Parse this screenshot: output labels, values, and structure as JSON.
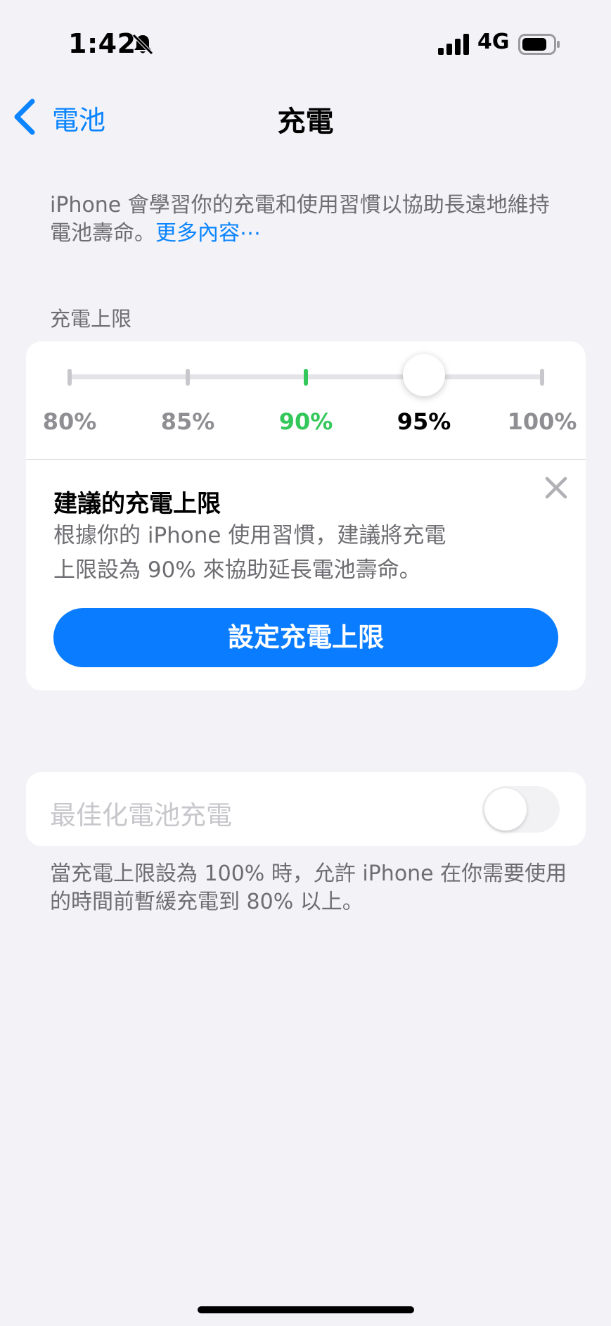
{
  "status_bar": {
    "time": "1:42",
    "network": "4G",
    "battery_level": 0.8,
    "icons": [
      "bell-slash-icon",
      "signal-icon",
      "battery-icon"
    ]
  },
  "nav": {
    "back_label": "電池",
    "title": "充電"
  },
  "description": {
    "text": "iPhone 會學習你的充電和使用習慣以協助長遠地維持電池壽命。",
    "link": "更多內容⋯"
  },
  "charge_limit": {
    "section_label": "充電上限",
    "options": [
      "80%",
      "85%",
      "90%",
      "95%",
      "100%"
    ],
    "selected": "95%",
    "recommended": "90%"
  },
  "suggestion": {
    "title": "建議的充電上限",
    "body_line1": "根據你的 iPhone 使用習慣，建議將充電",
    "body_line2": "上限設為 90% 來協助延長電池壽命。",
    "button_label": "設定充電上限"
  },
  "optimized": {
    "label": "最佳化電池充電",
    "enabled": false,
    "footnote": "當充電上限設為 100% 時，允許 iPhone 在你需要使用的時間前暫緩充電到 80% 以上。"
  },
  "colors": {
    "accent": "#0a84ff",
    "recommended": "#34c759",
    "background": "#f2f2f7"
  }
}
